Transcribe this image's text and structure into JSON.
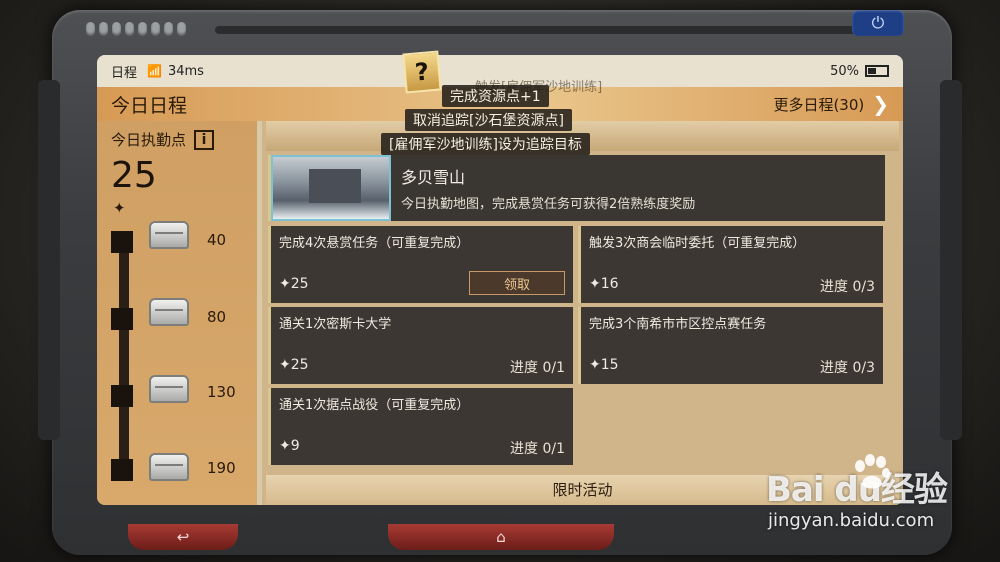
{
  "statusbar": {
    "schedule_label": "日程",
    "signal_ms": "34ms",
    "battery": "50%"
  },
  "header": {
    "title": "今日日程",
    "more_label": "更多日程(30)"
  },
  "sidebar": {
    "points_label": "今日执勤点",
    "info_icon": "i",
    "points_value": "25",
    "milestones": [
      {
        "value": "40"
      },
      {
        "value": "80"
      },
      {
        "value": "130"
      },
      {
        "value": "190"
      }
    ]
  },
  "popup": {
    "icon": "?",
    "ghost_text": "触发[雇佣军沙地训练]",
    "toasts": [
      "完成资源点+1",
      "取消追踪[沙石堡资源点]",
      "[雇佣军沙地训练]设为追踪目标"
    ]
  },
  "map_card": {
    "title": "多贝雪山",
    "description": "今日执勤地图，完成悬赏任务可获得2倍熟练度奖励"
  },
  "tasks": [
    {
      "title": "完成4次悬赏任务（可重复完成）",
      "reward": "25",
      "claim_label": "领取"
    },
    {
      "title": "触发3次商会临时委托（可重复完成）",
      "reward": "16",
      "progress": "进度 0/3"
    },
    {
      "title": "通关1次密斯卡大学",
      "reward": "25",
      "progress": "进度 0/1"
    },
    {
      "title": "完成3个南希市市区控点赛任务",
      "reward": "15",
      "progress": "进度 0/3"
    },
    {
      "title": "通关1次据点战役（可重复完成）",
      "reward": "9",
      "progress": "进度 0/1"
    }
  ],
  "limited_label": "限时活动",
  "bottom": {
    "back_icon": "↩",
    "home_icon": "⌂"
  },
  "power_icon": "⏻",
  "watermark": {
    "brand": "Bai  du经验",
    "url": "jingyan.baidu.com"
  }
}
